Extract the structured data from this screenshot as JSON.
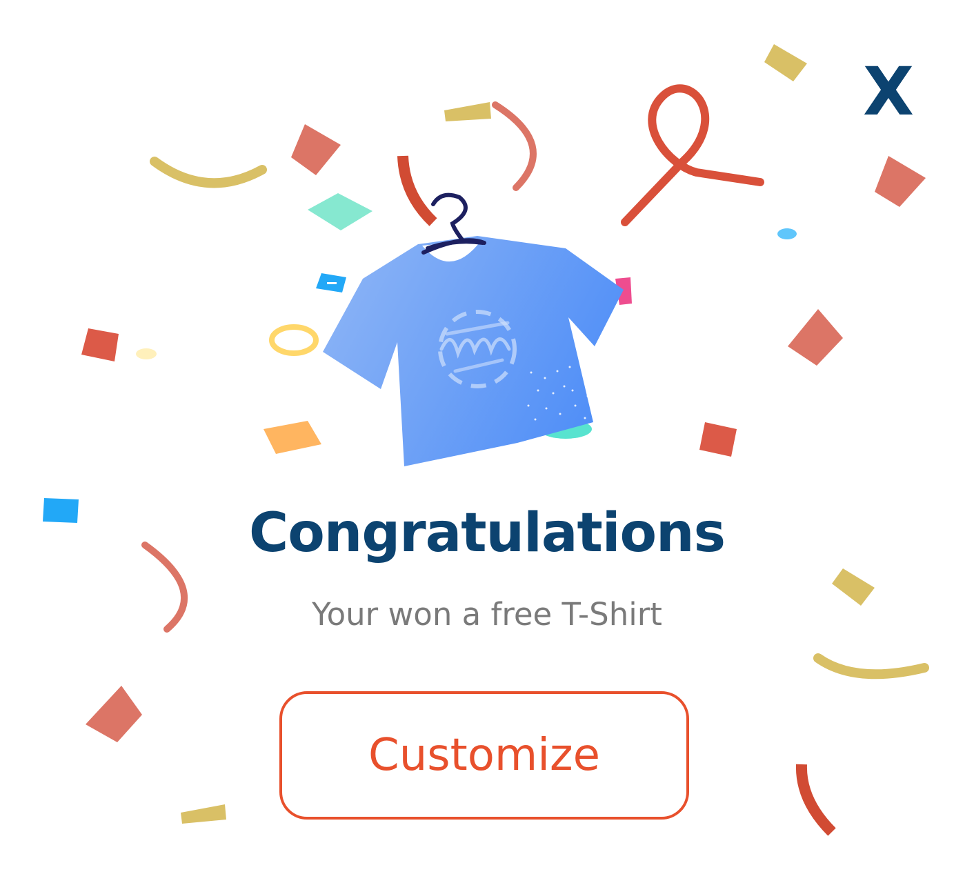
{
  "dialog": {
    "close_label": "X",
    "title": "Congratulations",
    "subtitle": "Your won a free T-Shirt",
    "customize_label": "Customize"
  },
  "colors": {
    "title": "#0c4370",
    "subtitle": "#7a7a7a",
    "accent": "#e8502c",
    "tshirt_light": "#8cb4f6",
    "tshirt_dark": "#4f8ef7",
    "confetti_red": "#dc5a48",
    "confetti_salmon": "#dc7566",
    "confetti_yellow": "#d9c066",
    "confetti_teal": "#86e8d0",
    "confetti_blue": "#22a8f7",
    "confetti_orange": "#ffb560"
  },
  "icons": {
    "close": "close-icon",
    "tshirt": "tshirt-on-hanger-illustration"
  }
}
